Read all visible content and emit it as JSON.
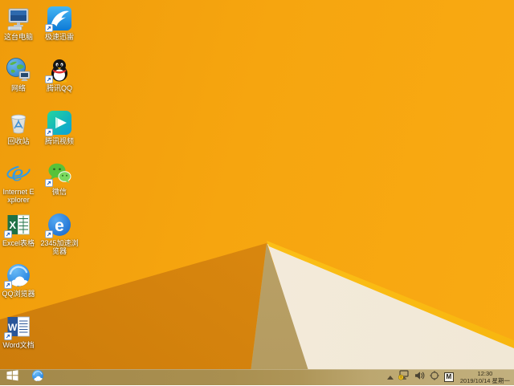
{
  "wallpaper": {
    "base_color": "#F6A50F",
    "facet_dark_color": "#D5830D",
    "facet_tan_color": "#B99F64",
    "facet_cream_color": "#F3EADA",
    "facet_stripe_color": "#FFC61D"
  },
  "desktop": {
    "icons": [
      {
        "id": "this-pc",
        "label": "这台电脑",
        "shortcut": false
      },
      {
        "id": "xunlei",
        "label": "极速迅雷",
        "shortcut": true
      },
      {
        "id": "network",
        "label": "网络",
        "shortcut": false
      },
      {
        "id": "tencent-qq",
        "label": "腾讯QQ",
        "shortcut": true
      },
      {
        "id": "recycle-bin",
        "label": "回收站",
        "shortcut": false
      },
      {
        "id": "tencent-video",
        "label": "腾讯视频",
        "shortcut": true
      },
      {
        "id": "internet-explorer",
        "label": "Internet Explorer",
        "shortcut": false
      },
      {
        "id": "wechat",
        "label": "微信",
        "shortcut": true
      },
      {
        "id": "excel",
        "label": "Excel表格",
        "shortcut": true
      },
      {
        "id": "browser-2345",
        "label": "2345加速浏览器",
        "shortcut": true
      },
      {
        "id": "qq-browser",
        "label": "QQ浏览器",
        "shortcut": true
      },
      {
        "id": "word",
        "label": "Word文档",
        "shortcut": true
      }
    ]
  },
  "icon_glyphs": {
    "ie": "e",
    "b2345": "e",
    "excel": "X",
    "word": "W"
  },
  "taskbar": {
    "start_icon": "windows-logo",
    "pinned": [
      "qq-browser"
    ],
    "tray": {
      "icon_names": [
        "hidden-icons-chevron",
        "network-status",
        "volume",
        "crosshair",
        "ime-indicator"
      ],
      "ime_label": "M",
      "time": "12:30",
      "date": "2019/10/14 星期一"
    }
  }
}
